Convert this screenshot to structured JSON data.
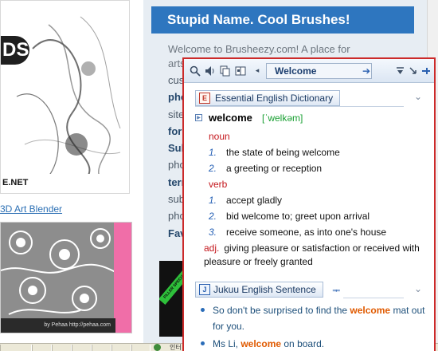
{
  "background_page": {
    "thumb_smoke_caption": "E.NET",
    "thumb_smoke_corner": "DS",
    "blender_link": "3D Art Blender",
    "floral_credit": "by Pehaa   http://pehaa.com",
    "header_title": "Stupid Name. Cool Brushes!",
    "intro_line_1": "Welcome to Brusheezy.com! A place for",
    "intro_line_2": "arts",
    "left_fragments": [
      {
        "text": "cus",
        "bold": false
      },
      {
        "text": "pho",
        "bold": true
      },
      {
        "text": "site",
        "bold": false
      },
      {
        "text": "for",
        "bold": true
      },
      {
        "text": "Sub",
        "bold": true
      },
      {
        "text": "pho",
        "bold": false
      },
      {
        "text": "terr",
        "bold": true
      },
      {
        "text": "sub",
        "bold": false
      },
      {
        "text": "pho",
        "bold": false
      },
      {
        "text": "Fav",
        "bold": true
      }
    ],
    "ad_badge": "FILLER SPECIAL",
    "status_text": "인터"
  },
  "popup": {
    "toolbar": {
      "search_icon": "magnifier-icon",
      "speaker_icon": "speaker-icon",
      "copy_icon": "copy-icon",
      "book_icon": "book-icon",
      "search_value": "Welcome",
      "go_icon": "arrow-right-icon",
      "pin_icons": [
        "filter-icon",
        "expand-icon",
        "pin-icon"
      ]
    },
    "dictionary_section": {
      "title": "Essential English Dictionary",
      "headword": "welcome",
      "phonetic": "[ˈwelkəm]",
      "entries": [
        {
          "pos": "noun",
          "senses": [
            "the state of being welcome",
            "a greeting or reception"
          ]
        },
        {
          "pos": "verb",
          "senses": [
            "accept gladly",
            "bid welcome to; greet upon arrival",
            "receive someone, as into one's house"
          ]
        }
      ],
      "adj_pos": "adj.",
      "adj_definition": "giving pleasure or satisfaction or received with pleasure or freely granted"
    },
    "sentence_section": {
      "title": "Jukuu English Sentence",
      "filter_mark": "ᆍ",
      "sentences": [
        {
          "before": "So don't be surprised to find the ",
          "highlight": "welcome",
          "after": " mat out for you."
        },
        {
          "before": "Ms Li, ",
          "highlight": "welcome",
          "after": " on board."
        }
      ]
    }
  },
  "colors": {
    "popup_border": "#cc2a2a",
    "pos_red": "#c4161c",
    "phonetic_green": "#1aa033",
    "highlight_orange": "#e05a00",
    "header_blue": "#2e76bf"
  }
}
